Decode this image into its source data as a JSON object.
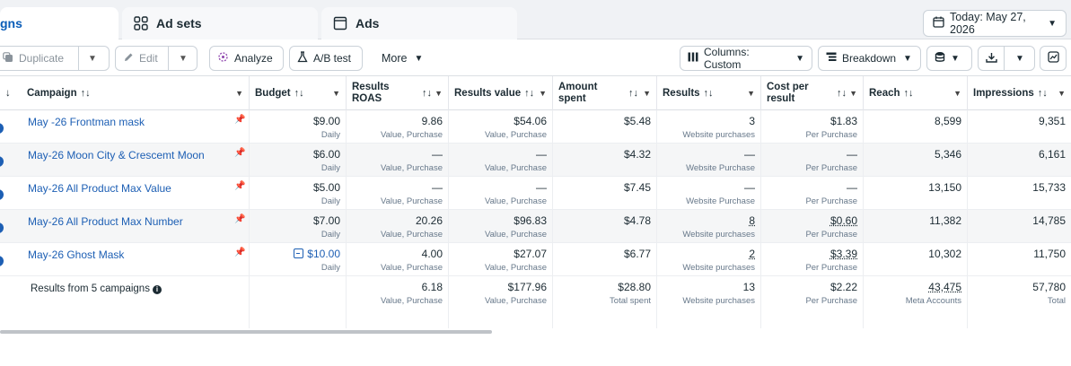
{
  "tabs": [
    {
      "label": "gns",
      "icon": "folder-icon"
    },
    {
      "label": "Ad sets",
      "icon": "grid-icon"
    },
    {
      "label": "Ads",
      "icon": "ad-page-icon"
    }
  ],
  "date_button": "Today: May 27, 2026",
  "toolbar": {
    "duplicate": "Duplicate",
    "edit": "Edit",
    "analyze": "Analyze",
    "ab_test": "A/B test",
    "more": "More",
    "columns": "Columns: Custom",
    "breakdown": "Breakdown"
  },
  "columns": {
    "campaign": "Campaign",
    "budget": "Budget",
    "results_roas_1": "Results",
    "results_roas_2": "ROAS",
    "results_value": "Results value",
    "amount_spent_1": "Amount",
    "amount_spent_2": "spent",
    "results": "Results",
    "cost_per_1": "Cost per",
    "cost_per_2": "result",
    "reach": "Reach",
    "impressions": "Impressions",
    "sort_glyph": "↑↓"
  },
  "rows": [
    {
      "name": "May -26 Frontman mask",
      "budget": "$9.00",
      "budget_sub": "Daily",
      "roas": "9.86",
      "roas_sub": "Value, Purchase",
      "value": "$54.06",
      "value_sub": "Value, Purchase",
      "spent": "$5.48",
      "results": "3",
      "results_sub": "Website purchases",
      "cpr": "$1.83",
      "cpr_sub": "Per Purchase",
      "reach": "8,599",
      "impr": "9,351"
    },
    {
      "name": "May-26 Moon City & Crescemt Moon",
      "budget": "$6.00",
      "budget_sub": "Daily",
      "roas": "—",
      "roas_sub": "Value, Purchase",
      "value": "—",
      "value_sub": "Value, Purchase",
      "spent": "$4.32",
      "results": "—",
      "results_sub": "Website Purchase",
      "cpr": "—",
      "cpr_sub": "Per Purchase",
      "reach": "5,346",
      "impr": "6,161"
    },
    {
      "name": "May-26 All Product Max Value",
      "budget": "$5.00",
      "budget_sub": "Daily",
      "roas": "—",
      "roas_sub": "Value, Purchase",
      "value": "—",
      "value_sub": "Value, Purchase",
      "spent": "$7.45",
      "results": "—",
      "results_sub": "Website Purchase",
      "cpr": "—",
      "cpr_sub": "Per Purchase",
      "reach": "13,150",
      "impr": "15,733"
    },
    {
      "name": "May-26 All Product Max Number",
      "budget": "$7.00",
      "budget_sub": "Daily",
      "roas": "20.26",
      "roas_sub": "Value, Purchase",
      "value": "$96.83",
      "value_sub": "Value, Purchase",
      "spent": "$4.78",
      "results": "8",
      "results_sub": "Website purchases",
      "cpr": "$0.60",
      "cpr_sub": "Per Purchase",
      "reach": "11,382",
      "impr": "14,785"
    },
    {
      "name": "May-26 Ghost Mask",
      "budget": "$10.00",
      "budget_sub": "Daily",
      "roas": "4.00",
      "roas_sub": "Value, Purchase",
      "value": "$27.07",
      "value_sub": "Value, Purchase",
      "spent": "$6.77",
      "results": "2",
      "results_sub": "Website purchases",
      "cpr": "$3.39",
      "cpr_sub": "Per Purchase",
      "reach": "10,302",
      "impr": "11,750"
    }
  ],
  "summary": {
    "label": "Results from 5 campaigns",
    "roas": "6.18",
    "roas_sub": "Value, Purchase",
    "value": "$177.96",
    "value_sub": "Value, Purchase",
    "spent": "$28.80",
    "spent_sub": "Total spent",
    "results": "13",
    "results_sub": "Website purchases",
    "cpr": "$2.22",
    "cpr_sub": "Per Purchase",
    "reach": "43,475",
    "reach_sub": "Meta Accounts",
    "impr": "57,780",
    "impr_sub": "Total"
  }
}
